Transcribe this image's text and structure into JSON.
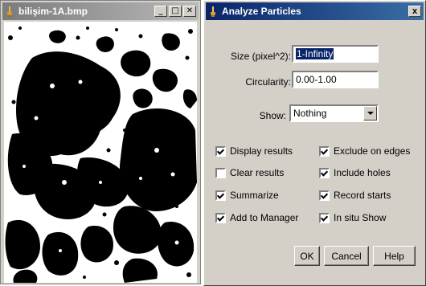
{
  "image_window": {
    "title": "bilişim-1A.bmp",
    "buttons": {
      "minimize": "_",
      "maximize": "□",
      "close": "✕"
    }
  },
  "dialog": {
    "title": "Analyze Particles",
    "close": "x",
    "size_label": "Size (pixel^2):",
    "size_value": "1-Infinity",
    "circularity_label": "Circularity:",
    "circularity_value": "0.00-1.00",
    "show_label": "Show:",
    "show_value": "Nothing",
    "checkboxes": [
      {
        "label": "Display results",
        "checked": true
      },
      {
        "label": "Exclude on edges",
        "checked": true
      },
      {
        "label": "Clear results",
        "checked": false
      },
      {
        "label": "Include holes",
        "checked": true
      },
      {
        "label": "Summarize",
        "checked": true
      },
      {
        "label": "Record starts",
        "checked": true
      },
      {
        "label": "Add to Manager",
        "checked": true
      },
      {
        "label": "In situ Show",
        "checked": true
      }
    ],
    "buttons": {
      "ok": "OK",
      "cancel": "Cancel",
      "help": "Help"
    }
  },
  "colors": {
    "active_title": "#0a246a",
    "inactive_title": "#7b7b7b",
    "face": "#d4d0c8"
  }
}
